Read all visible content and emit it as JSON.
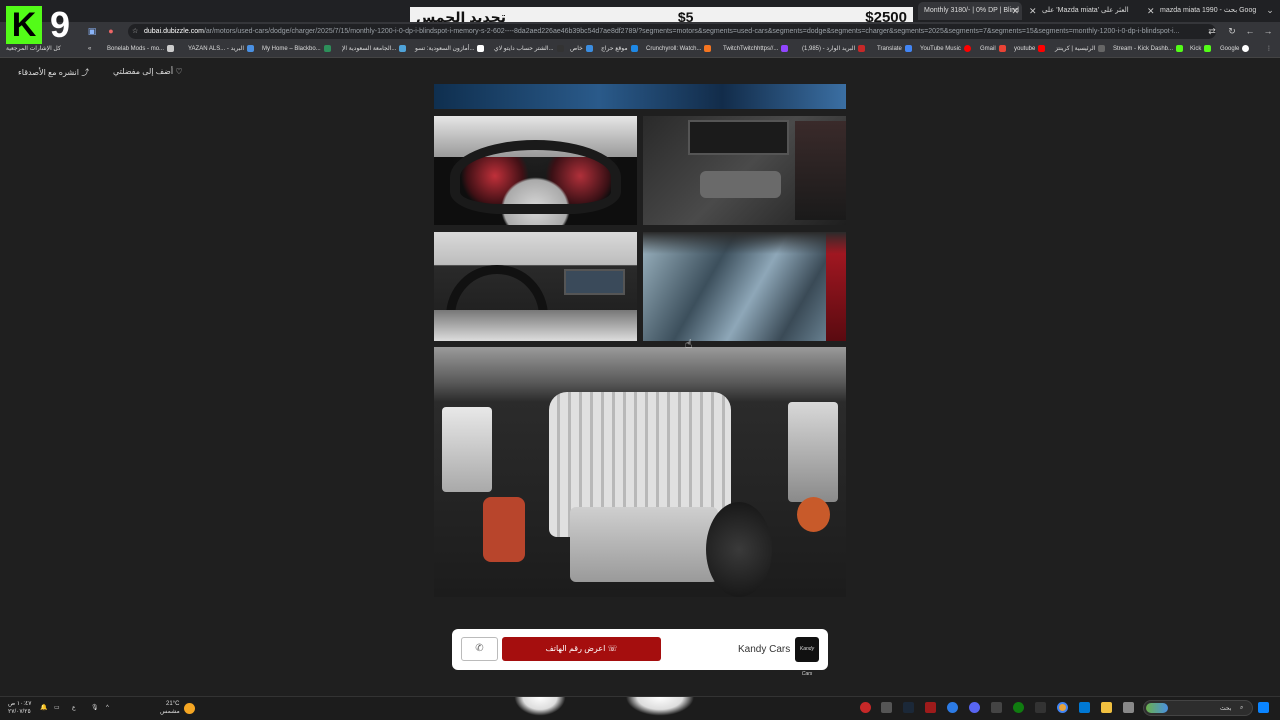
{
  "overlay": {
    "logo_letter": "K",
    "logo_number": "9"
  },
  "donation": {
    "amount": "$2500",
    "price": "$5",
    "message": "تجديد الجمس"
  },
  "tabs": [
    {
      "label": "Monthly 3180/- | 0% DP | Blind"
    },
    {
      "label": "على 'Mazda miata' العثر على"
    },
    {
      "label": "mazda miata 1990 - بحث Goog"
    }
  ],
  "address": {
    "host": "dubai.dubizzle.com",
    "path": "/ar/motors/used-cars/dodge/charger/2025/7/15/monthly-1200-i-0-dp-i-blindspot-i-memory-s-2-602----8da2aed226ae46b39bc54d7ae8df2789/?segments=motors&segments=used-cars&segments=dodge&segments=charger&segments=2025&segments=7&segments=15&segments=monthly-1200-i-0-dp-i-blindspot-i..."
  },
  "bookmarks": {
    "all_bookmarks": "كل الإشارات المرجعية",
    "items": [
      "Bonelab Mods - mo...",
      "YAZAN ALS... - البريد",
      "My Home – Blackbo...",
      "الجامعة السعودية الإ...",
      "أمازون السعودية: تسو...",
      "الشتر حساب دايتو لاي...",
      "خاص",
      "موقع حراج",
      "Crunchyroll: Watch...",
      "TwitchTwitchhttps//...",
      "البريد الوارد - (1,985)",
      "Translate",
      "YouTube Music",
      "Gmail",
      "youtube",
      "الرئيسية | كرينتز",
      "Stream - Kick Dashb...",
      "Kick",
      "Google"
    ]
  },
  "page_header": {
    "add_favorite": "أضف إلى مفضلتي",
    "share": "انشره مع الأصدقاء"
  },
  "contact": {
    "call_label": "اعرض رقم الهاتف",
    "dealer": "Kandy Cars",
    "dealer_logo": "Kandy Cars"
  },
  "taskbar": {
    "search": "بحث",
    "weather_temp": "21°C",
    "weather_desc": "مشمس",
    "time": "١٠:٤٧ ص",
    "date": "٢٧/٠٧/٢٥",
    "lang": "ع"
  },
  "colors": {
    "accent": "#a50e0e",
    "kick_green": "#53fc18",
    "page_bg": "#1f1f1f"
  }
}
